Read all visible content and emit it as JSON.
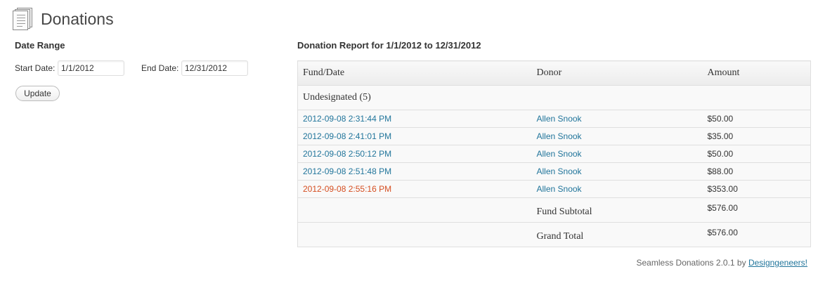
{
  "header": {
    "title": "Donations",
    "icon": "document-icon"
  },
  "date_range": {
    "title": "Date Range",
    "start_label": "Start Date:",
    "start_value": "1/1/2012",
    "end_label": "End Date:",
    "end_value": "12/31/2012",
    "update_label": "Update"
  },
  "report": {
    "title": "Donation Report for 1/1/2012 to 12/31/2012",
    "columns": [
      "Fund/Date",
      "Donor",
      "Amount"
    ],
    "group_label": "Undesignated (5)",
    "rows": [
      {
        "date": "2012-09-08 2:31:44 PM",
        "donor": "Allen Snook",
        "amount": "$50.00"
      },
      {
        "date": "2012-09-08 2:41:01 PM",
        "donor": "Allen Snook",
        "amount": "$35.00"
      },
      {
        "date": "2012-09-08 2:50:12 PM",
        "donor": "Allen Snook",
        "amount": "$50.00"
      },
      {
        "date": "2012-09-08 2:51:48 PM",
        "donor": "Allen Snook",
        "amount": "$88.00"
      },
      {
        "date": "2012-09-08 2:55:16 PM",
        "donor": "Allen Snook",
        "amount": "$353.00"
      }
    ],
    "fund_subtotal_label": "Fund Subtotal",
    "fund_subtotal_value": "$576.00",
    "grand_total_label": "Grand Total",
    "grand_total_value": "$576.00"
  },
  "footer": {
    "text": "Seamless Donations 2.0.1 by",
    "link": "Designgeneers!"
  },
  "colors": {
    "link": "#21759b",
    "link_hover": "#d54e21",
    "text": "#333333"
  }
}
